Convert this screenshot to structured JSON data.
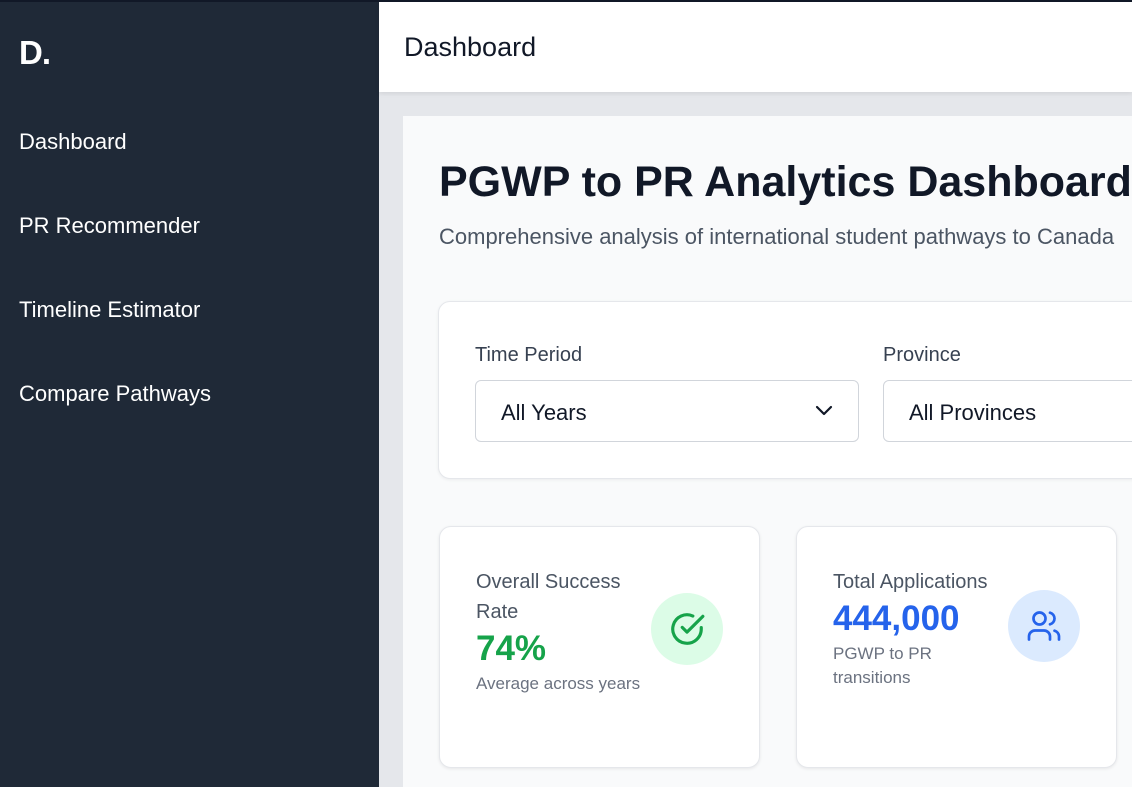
{
  "sidebar": {
    "logo": "D.",
    "items": [
      {
        "label": "Dashboard"
      },
      {
        "label": "PR Recommender"
      },
      {
        "label": "Timeline Estimator"
      },
      {
        "label": "Compare Pathways"
      }
    ]
  },
  "header": {
    "title": "Dashboard"
  },
  "main": {
    "title": "PGWP to PR Analytics Dashboard",
    "subtitle": "Comprehensive analysis of international student pathways to Canada",
    "filters": [
      {
        "label": "Time Period",
        "value": "All Years",
        "icon": "chevron-down-icon"
      },
      {
        "label": "Province",
        "value": "All Provinces",
        "icon": "chevron-down-icon"
      }
    ],
    "stats": [
      {
        "title": "Overall Success Rate",
        "value": "74%",
        "note": "Average across years",
        "icon": "check-circle-icon",
        "color": "#16a34a",
        "icon_bg": "#dcfce7"
      },
      {
        "title": "Total Applications",
        "value": "444,000",
        "note": "PGWP to PR transitions",
        "icon": "users-icon",
        "color": "#2563eb",
        "icon_bg": "#dbeafe"
      }
    ]
  },
  "colors": {
    "sidebar_bg": "#1f2937",
    "success": "#16a34a",
    "primary": "#2563eb"
  }
}
